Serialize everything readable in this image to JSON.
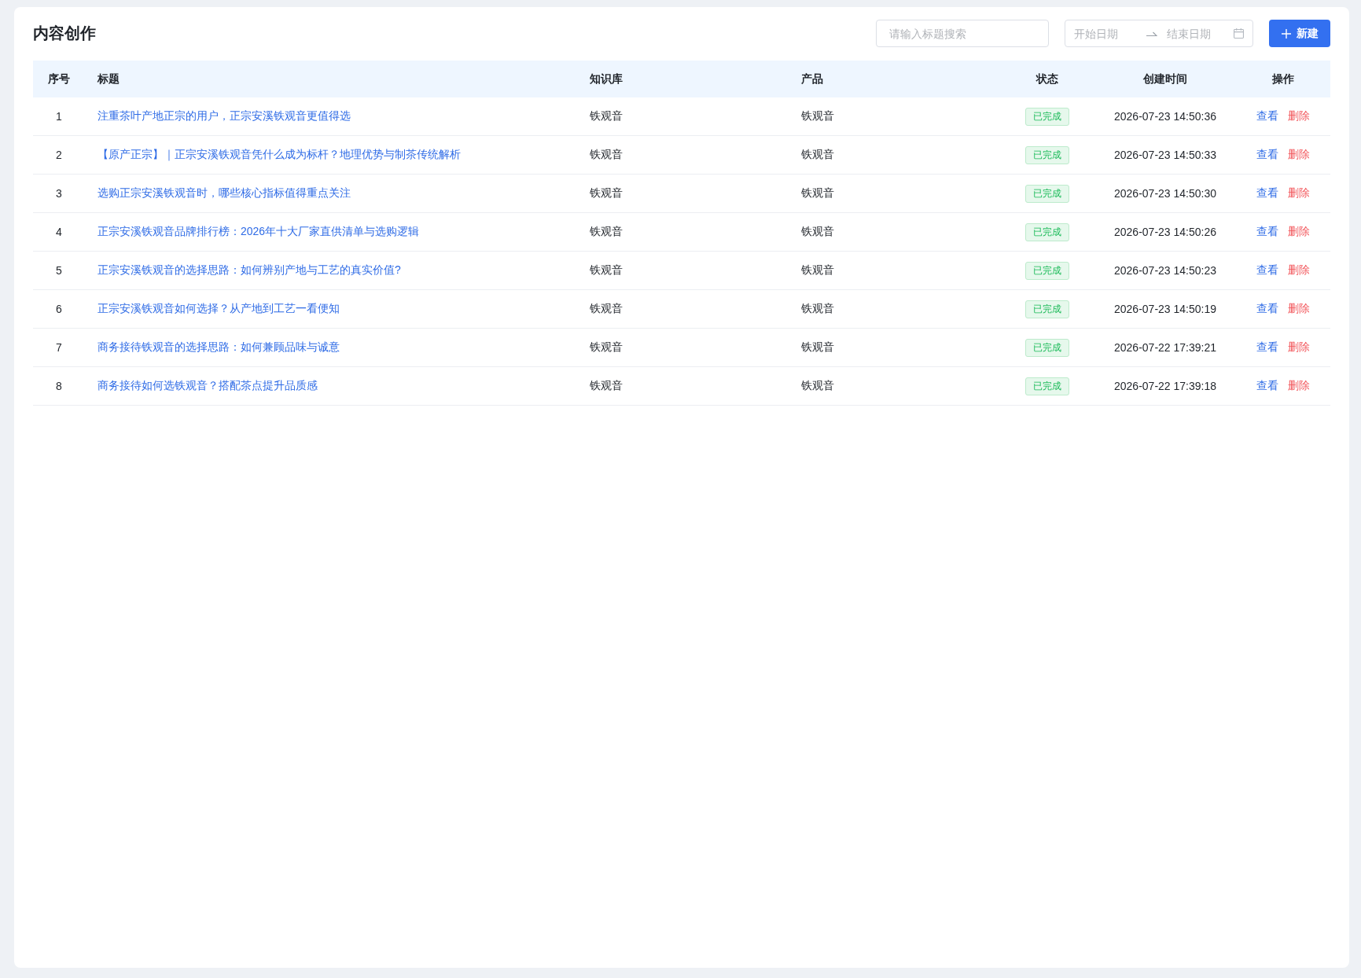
{
  "page": {
    "title": "内容创作"
  },
  "toolbar": {
    "search": {
      "placeholder": "请输入标题搜索"
    },
    "date_range": {
      "start_placeholder": "开始日期",
      "end_placeholder": "结束日期"
    },
    "new_button": {
      "label": "新建"
    }
  },
  "table": {
    "columns": [
      "序号",
      "标题",
      "知识库",
      "产品",
      "状态",
      "创建时间",
      "操作"
    ],
    "rows": [
      {
        "index": "1",
        "title": "注重茶叶产地正宗的用户，正宗安溪铁观音更值得选",
        "knowledge_base": "铁观音",
        "product": "铁观音",
        "status": "已完成",
        "created": "2026-07-23 14:50:36",
        "actions": [
          {
            "label": "查看",
            "kind": "view"
          },
          {
            "label": "删除",
            "kind": "delete"
          }
        ]
      },
      {
        "index": "2",
        "title": "【原产正宗】｜正宗安溪铁观音凭什么成为标杆？地理优势与制茶传统解析",
        "knowledge_base": "铁观音",
        "product": "铁观音",
        "status": "已完成",
        "created": "2026-07-23 14:50:33",
        "actions": [
          {
            "label": "查看",
            "kind": "view"
          },
          {
            "label": "删除",
            "kind": "delete"
          }
        ]
      },
      {
        "index": "3",
        "title": "选购正宗安溪铁观音时，哪些核心指标值得重点关注",
        "knowledge_base": "铁观音",
        "product": "铁观音",
        "status": "已完成",
        "created": "2026-07-23 14:50:30",
        "actions": [
          {
            "label": "查看",
            "kind": "view"
          },
          {
            "label": "删除",
            "kind": "delete"
          }
        ]
      },
      {
        "index": "4",
        "title": "正宗安溪铁观音品牌排行榜：2026年十大厂家直供清单与选购逻辑",
        "knowledge_base": "铁观音",
        "product": "铁观音",
        "status": "已完成",
        "created": "2026-07-23 14:50:26",
        "actions": [
          {
            "label": "查看",
            "kind": "view"
          },
          {
            "label": "删除",
            "kind": "delete"
          }
        ]
      },
      {
        "index": "5",
        "title": "正宗安溪铁观音的选择思路：如何辨别产地与工艺的真实价值?",
        "knowledge_base": "铁观音",
        "product": "铁观音",
        "status": "已完成",
        "created": "2026-07-23 14:50:23",
        "actions": [
          {
            "label": "查看",
            "kind": "view"
          },
          {
            "label": "删除",
            "kind": "delete"
          }
        ]
      },
      {
        "index": "6",
        "title": "正宗安溪铁观音如何选择？从产地到工艺一看便知",
        "knowledge_base": "铁观音",
        "product": "铁观音",
        "status": "已完成",
        "created": "2026-07-23 14:50:19",
        "actions": [
          {
            "label": "查看",
            "kind": "view"
          },
          {
            "label": "删除",
            "kind": "delete"
          }
        ]
      },
      {
        "index": "7",
        "title": "商务接待铁观音的选择思路：如何兼顾品味与诚意",
        "knowledge_base": "铁观音",
        "product": "铁观音",
        "status": "已完成",
        "created": "2026-07-22 17:39:21",
        "actions": [
          {
            "label": "查看",
            "kind": "view"
          },
          {
            "label": "删除",
            "kind": "delete"
          }
        ]
      },
      {
        "index": "8",
        "title": "商务接待如何选铁观音？搭配茶点提升品质感",
        "knowledge_base": "铁观音",
        "product": "铁观音",
        "status": "已完成",
        "created": "2026-07-22 17:39:18",
        "actions": [
          {
            "label": "查看",
            "kind": "view"
          },
          {
            "label": "删除",
            "kind": "delete"
          }
        ]
      }
    ]
  }
}
